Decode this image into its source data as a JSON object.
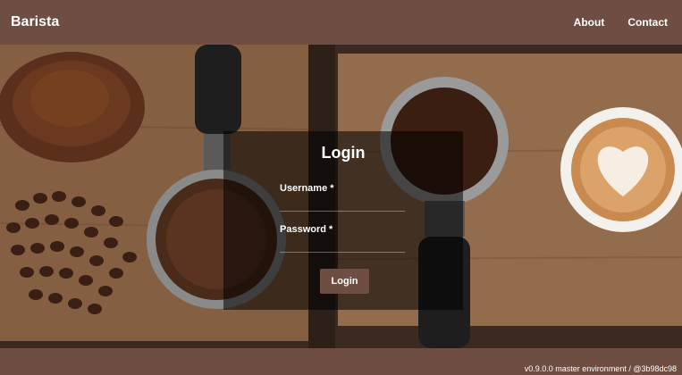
{
  "navbar": {
    "brand": "Barista",
    "links": [
      {
        "label": "About"
      },
      {
        "label": "Contact"
      }
    ]
  },
  "login": {
    "title": "Login",
    "username_label": "Username *",
    "username_value": "",
    "password_label": "Password *",
    "password_value": "",
    "submit_label": "Login"
  },
  "footer": {
    "version": "v0.9.0.0 master environment / @3b98dc98"
  },
  "colors": {
    "brand": "#6e4d42",
    "overlay": "rgba(0,0,0,0.55)"
  }
}
